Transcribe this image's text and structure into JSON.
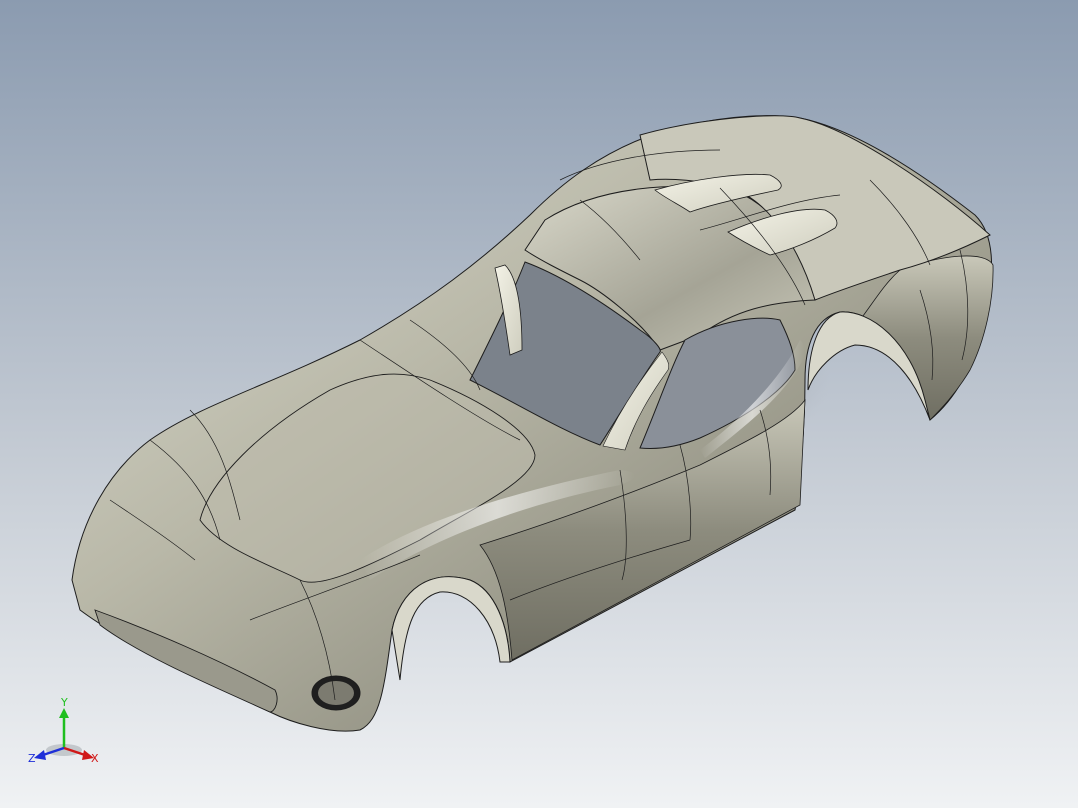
{
  "viewport": {
    "background_top": "#8b9bb0",
    "background_bottom": "#f0f2f4",
    "model": {
      "name": "car-body",
      "surface_color": "#c2c1b2",
      "edge_color": "#1d1d1d"
    }
  },
  "triad": {
    "axes": [
      {
        "label": "Y",
        "color": "#1fbf1f"
      },
      {
        "label": "X",
        "color": "#d01818"
      },
      {
        "label": "Z",
        "color": "#1e2fd8"
      }
    ]
  }
}
